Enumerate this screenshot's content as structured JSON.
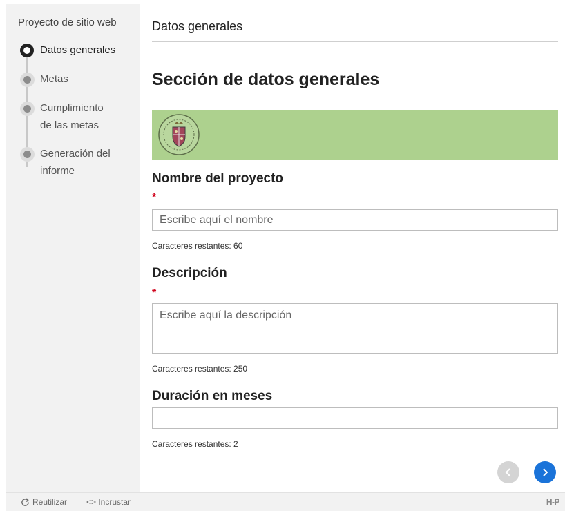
{
  "sidebar": {
    "title": "Proyecto de sitio web",
    "steps": [
      {
        "label": "Datos generales",
        "state": "active"
      },
      {
        "label": "Metas",
        "state": "pending"
      },
      {
        "label": "Cumplimiento de las metas",
        "state": "pending"
      },
      {
        "label": "Generación del informe",
        "state": "pending"
      }
    ]
  },
  "main": {
    "page_header": "Datos generales",
    "section_title": "Sección de datos generales",
    "banner_color": "#add18e",
    "fields": {
      "name": {
        "label": "Nombre del proyecto",
        "required_mark": "*",
        "value": "",
        "placeholder": "Escribe aquí el nombre",
        "counter": "Caracteres restantes: 60"
      },
      "description": {
        "label": "Descripción",
        "required_mark": "*",
        "value": "",
        "placeholder": "Escribe aquí la descripción",
        "counter": "Caracteres restantes: 250"
      },
      "duration": {
        "label": "Duración en meses",
        "value": "",
        "placeholder": "",
        "counter": "Caracteres restantes: 2"
      }
    },
    "navigation": {
      "prev_icon": "chevron-left-icon",
      "next_icon": "chevron-right-icon",
      "accent_color": "#1a73d9"
    }
  },
  "footer": {
    "reuse_label": "Reutilizar",
    "embed_label": "<> Incrustar",
    "logo_text": "H-P"
  }
}
